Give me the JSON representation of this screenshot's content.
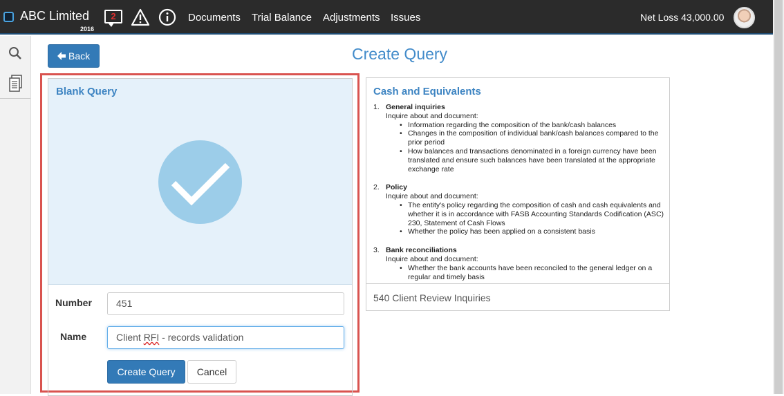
{
  "app": {
    "company": "ABC Limited",
    "year": "2016"
  },
  "topbar": {
    "notifications_count": "2",
    "nav": [
      "Documents",
      "Trial Balance",
      "Adjustments",
      "Issues"
    ],
    "net_loss": "Net Loss 43,000.00"
  },
  "page": {
    "title": "Create Query",
    "back_label": "Back"
  },
  "left_card": {
    "title": "Blank Query",
    "number_label": "Number",
    "number_value": "451",
    "name_label": "Name",
    "name_value_prefix": "Client ",
    "name_value_misspelled": "RFI",
    "name_value_suffix": " - records validation",
    "create_label": "Create Query",
    "cancel_label": "Cancel"
  },
  "right_card": {
    "title": "Cash and Equivalents",
    "footer": "540 Client Review Inquiries",
    "sections": [
      {
        "num": "1.",
        "heading": "General inquiries",
        "intro": "Inquire about and document:",
        "items": [
          "Information regarding the composition of the bank/cash balances",
          "Changes in the composition of individual bank/cash balances compared to the prior period",
          "How balances and transactions denominated in a foreign currency have been translated and ensure such balances have been translated at the appropriate exchange rate"
        ]
      },
      {
        "num": "2.",
        "heading": "Policy",
        "intro": "Inquire about and document:",
        "items": [
          "The entity's policy regarding the composition of cash and cash equivalents and whether it is in accordance with FASB Accounting Standards Codification (ASC) 230, Statement of Cash Flows",
          "Whether the policy has been applied on a consistent basis"
        ]
      },
      {
        "num": "3.",
        "heading": "Bank reconciliations",
        "intro": "Inquire about and document:",
        "items": [
          "Whether the bank accounts have been reconciled to the general ledger on a regular and timely basis"
        ]
      }
    ]
  }
}
